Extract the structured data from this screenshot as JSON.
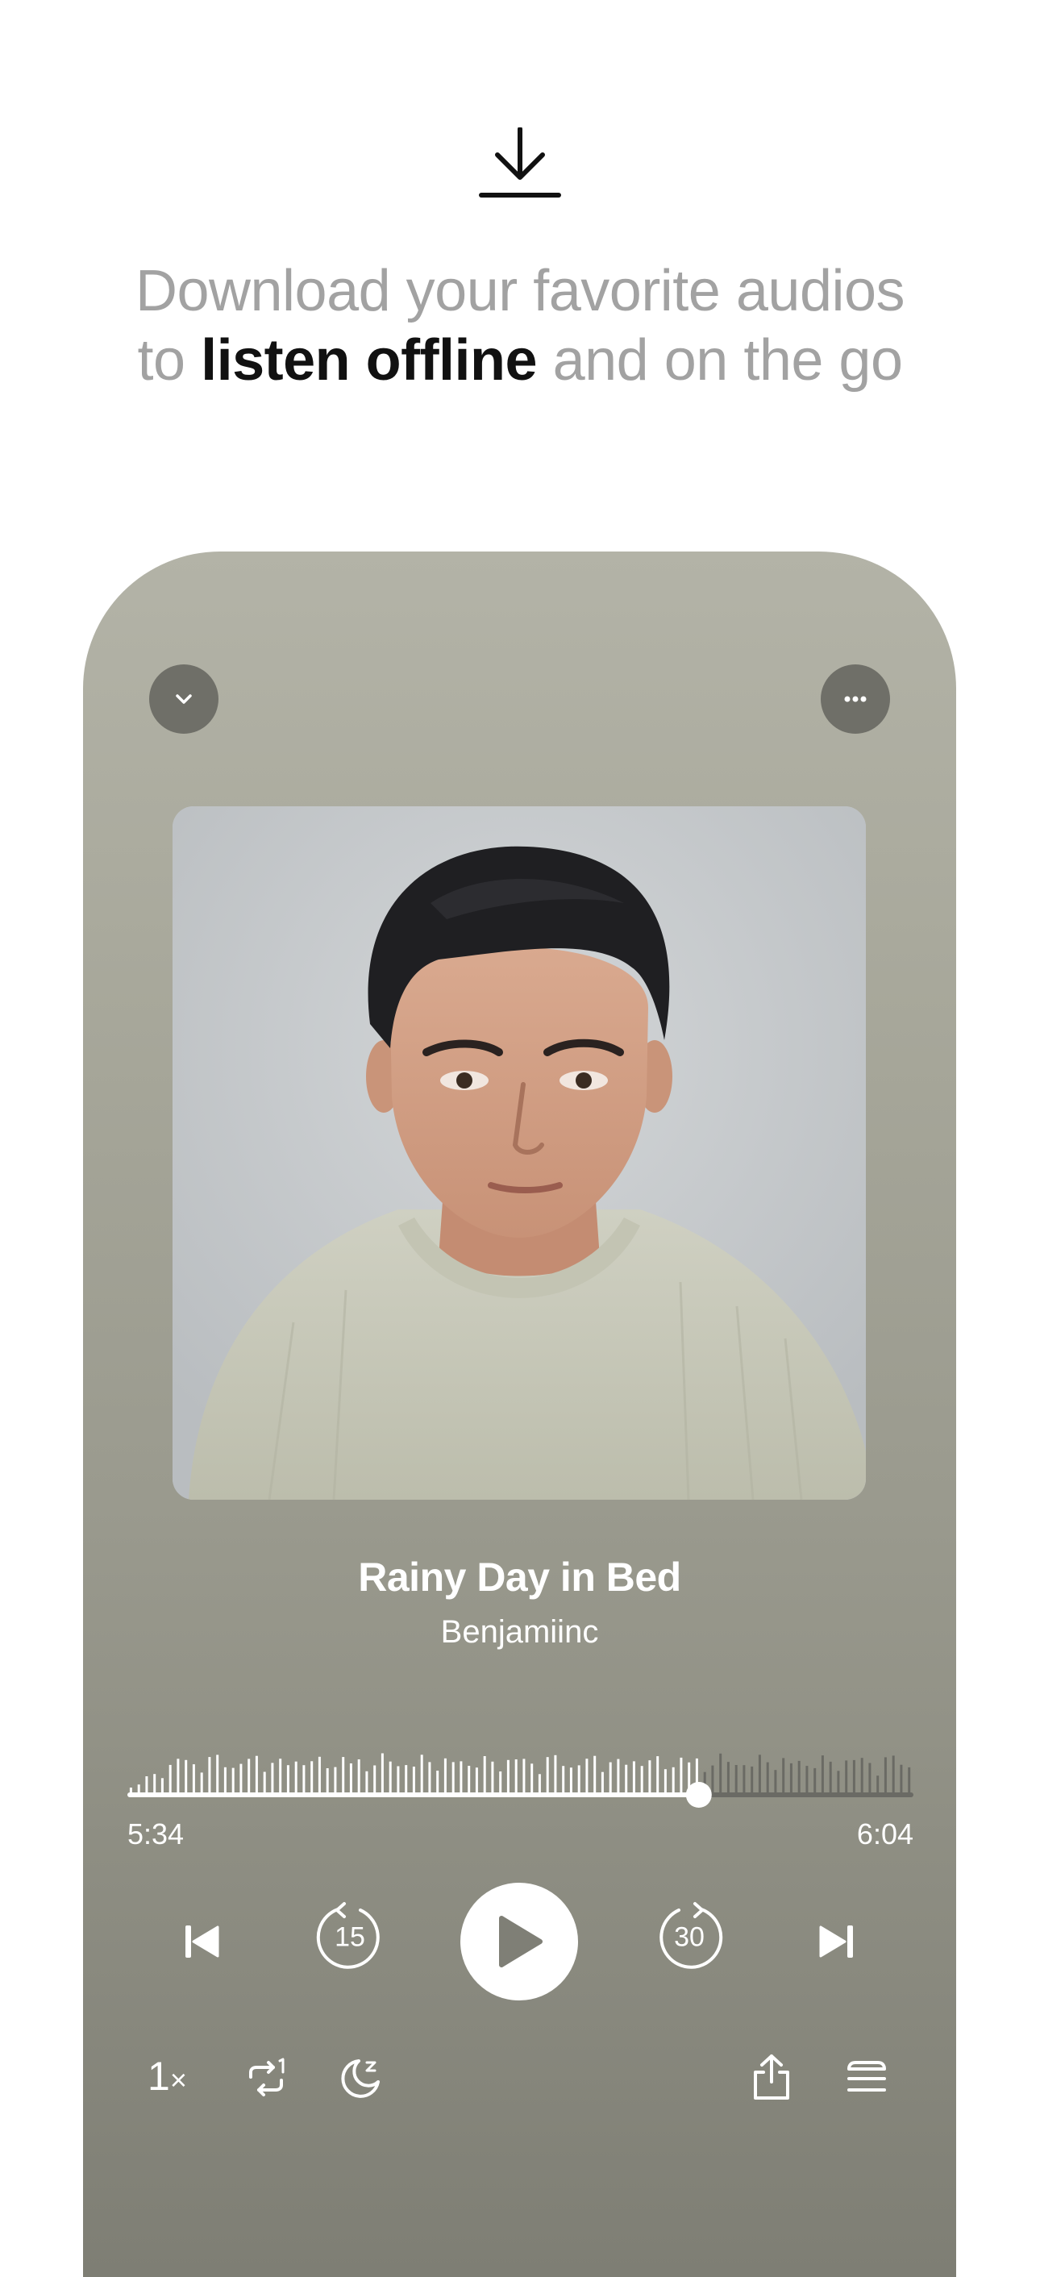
{
  "headline": {
    "part1": "Download your favorite audios",
    "part2_prefix": "to ",
    "part2_bold": "listen offline",
    "part2_suffix": " and on the go"
  },
  "player": {
    "track_title": "Rainy Day in Bed",
    "artist": "Benjamiinc",
    "elapsed_time": "5:34",
    "total_time": "6:04",
    "progress": 0.727,
    "skip_back_seconds": "15",
    "skip_forward_seconds": "30",
    "speed_value": "1",
    "speed_suffix": "×"
  },
  "icons": {
    "hero": "download-icon",
    "collapse": "chevron-down-icon",
    "more": "ellipsis-icon",
    "previous": "skip-previous-icon",
    "rewind": "rewind-15-icon",
    "play": "play-icon",
    "forward": "forward-30-icon",
    "next": "skip-next-icon",
    "repeat": "repeat-one-icon",
    "sleep": "sleep-timer-icon",
    "share": "share-icon",
    "queue": "queue-icon"
  },
  "colors": {
    "headline_muted": "#a2a2a2",
    "headline_strong": "#111111",
    "phone_top": "#b3b3a7",
    "phone_bottom": "#7e7e74",
    "button_bg": "#6f6f68",
    "waveform_played": "#ffffff",
    "waveform_remaining": "#6a6a64"
  }
}
